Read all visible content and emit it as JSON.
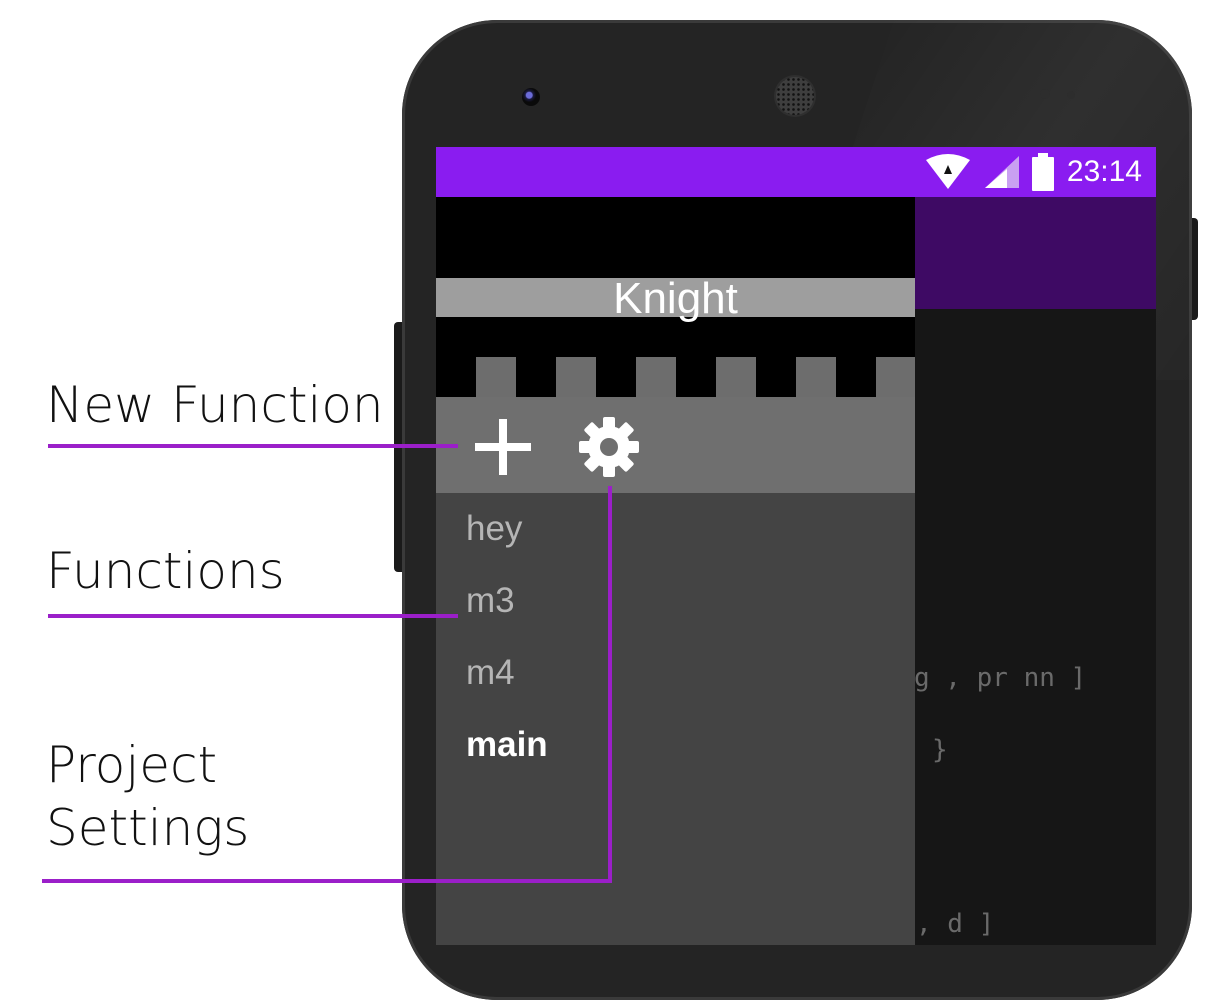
{
  "status_bar": {
    "time": "23:14",
    "background_color": "#8a1cf0",
    "icons": [
      "wifi-icon",
      "cell-signal-icon",
      "battery-icon"
    ]
  },
  "app_bar": {
    "background_color": "#3e0a64"
  },
  "code_lines": [
    "g , pr nn ]",
    "}",
    ", d ]"
  ],
  "drawer": {
    "project_name": "Knight",
    "toolbar": {
      "add_icon": "plus-icon",
      "settings_icon": "gear-icon"
    },
    "functions": [
      {
        "name": "hey",
        "active": false
      },
      {
        "name": "m3",
        "active": false
      },
      {
        "name": "m4",
        "active": false
      },
      {
        "name": "main",
        "active": true
      }
    ]
  },
  "callouts": {
    "new_function": "New Function",
    "functions": "Functions",
    "project_settings": "Project\nSettings",
    "line_color": "#9b1fc9"
  }
}
